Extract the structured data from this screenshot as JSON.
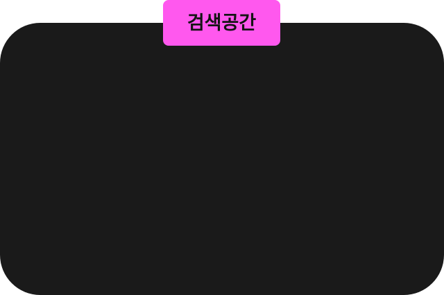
{
  "search_space": {
    "tag_label": "검색공간"
  },
  "colors": {
    "panel_background": "#1a1a1a",
    "tag_background": "#ff58ee",
    "tag_text": "#141414",
    "page_background": "#ffffff"
  }
}
